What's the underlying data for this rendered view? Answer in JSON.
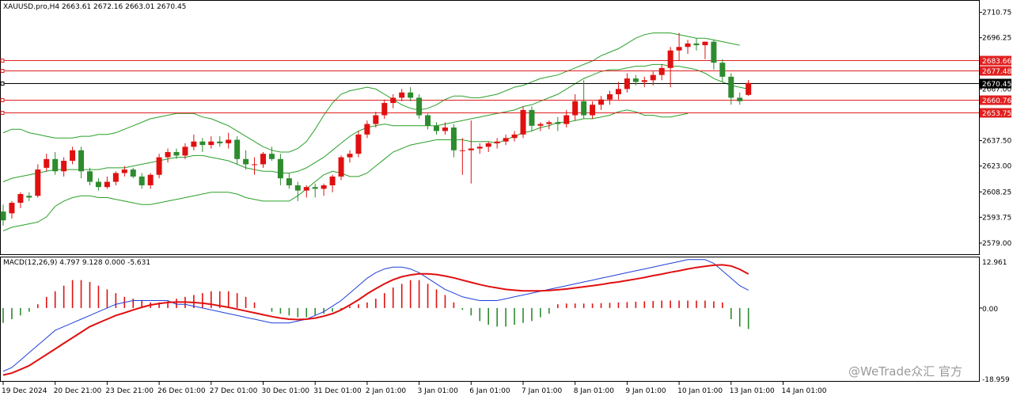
{
  "header": {
    "symbol_text": "XAUUSD.pro,H4  2663.61 2672.16 2663.01 2670.45"
  },
  "macd": {
    "label": "MACD(12,26,9) 4.797 9.128 0.000 -5.631",
    "axis": {
      "top": "12.961",
      "zero": "0.00",
      "bottom": "-18.959"
    },
    "colors": {
      "macd_line": "#1f3fd8",
      "signal_line": "#e01010",
      "hist_pos": "#e01010",
      "hist_neg": "#2e8b2e"
    }
  },
  "price_axis": {
    "labels": [
      "2710.75",
      "2696.25",
      "2683.66",
      "2677.48",
      "2670.45",
      "2667.00",
      "2660.76",
      "2653.75",
      "2637.50",
      "2623.00",
      "2608.25",
      "2593.75",
      "2579.00"
    ]
  },
  "levels": [
    {
      "value": 2683.66,
      "label": "2683.66",
      "color": "#e02020"
    },
    {
      "value": 2677.48,
      "label": "2677.48",
      "color": "#e02020"
    },
    {
      "value": 2670.45,
      "label": "2670.45",
      "color": "#000000"
    },
    {
      "value": 2660.76,
      "label": "2660.76",
      "color": "#e02020"
    },
    {
      "value": 2653.75,
      "label": "2653.75",
      "color": "#e02020"
    }
  ],
  "time_axis": {
    "labels": [
      "19 Dec 2024",
      "20 Dec 21:00",
      "23 Dec 21:00",
      "26 Dec 01:00",
      "27 Dec 01:00",
      "30 Dec 01:00",
      "31 Dec 01:00",
      "2 Jan 01:00",
      "3 Jan 01:00",
      "6 Jan 01:00",
      "7 Jan 01:00",
      "8 Jan 01:00",
      "9 Jan 01:00",
      "10 Jan 01:00",
      "13 Jan 01:00",
      "14 Jan 01:00"
    ]
  },
  "watermark": "@WeTrade众汇 官方",
  "colors": {
    "bull": "#e01010",
    "bear": "#2e8b2e",
    "band": "#2aa02a",
    "grid": "#c8c8c8",
    "current_label_bg": "#000000"
  },
  "chart_data": {
    "type": "candlestick",
    "symbol": "XAUUSD.pro",
    "timeframe": "H4",
    "ylim": [
      2574,
      2716
    ],
    "ohlc": [
      [
        2597,
        2601,
        2589,
        2592
      ],
      [
        2596,
        2603,
        2593,
        2602
      ],
      [
        2602,
        2608,
        2599,
        2607
      ],
      [
        2606,
        2608,
        2603,
        2605
      ],
      [
        2606,
        2624,
        2605,
        2621
      ],
      [
        2622,
        2630,
        2620,
        2627
      ],
      [
        2627,
        2631,
        2618,
        2620
      ],
      [
        2620,
        2628,
        2617,
        2626
      ],
      [
        2626,
        2634,
        2624,
        2632
      ],
      [
        2632,
        2634,
        2616,
        2620
      ],
      [
        2620,
        2622,
        2612,
        2614
      ],
      [
        2614,
        2616,
        2609,
        2611
      ],
      [
        2611,
        2617,
        2610,
        2614
      ],
      [
        2614,
        2620,
        2612,
        2619
      ],
      [
        2619,
        2623,
        2617,
        2621
      ],
      [
        2621,
        2622,
        2616,
        2617
      ],
      [
        2617,
        2619,
        2610,
        2612
      ],
      [
        2612,
        2619,
        2610,
        2618
      ],
      [
        2618,
        2630,
        2616,
        2628
      ],
      [
        2628,
        2633,
        2625,
        2631
      ],
      [
        2631,
        2633,
        2627,
        2629
      ],
      [
        2629,
        2636,
        2627,
        2634
      ],
      [
        2634,
        2641,
        2632,
        2637
      ],
      [
        2637,
        2639,
        2631,
        2635
      ],
      [
        2635,
        2640,
        2633,
        2637
      ],
      [
        2637,
        2640,
        2634,
        2636
      ],
      [
        2636,
        2642,
        2633,
        2638
      ],
      [
        2638,
        2640,
        2624,
        2627
      ],
      [
        2627,
        2632,
        2621,
        2624
      ],
      [
        2624,
        2628,
        2618,
        2624
      ],
      [
        2624,
        2631,
        2622,
        2630
      ],
      [
        2630,
        2634,
        2626,
        2627
      ],
      [
        2627,
        2630,
        2612,
        2616
      ],
      [
        2616,
        2619,
        2610,
        2612
      ],
      [
        2612,
        2614,
        2603,
        2609
      ],
      [
        2609,
        2612,
        2605,
        2611
      ],
      [
        2611,
        2613,
        2605,
        2610
      ],
      [
        2610,
        2613,
        2606,
        2612
      ],
      [
        2612,
        2618,
        2608,
        2617
      ],
      [
        2617,
        2629,
        2615,
        2628
      ],
      [
        2628,
        2632,
        2625,
        2630
      ],
      [
        2630,
        2643,
        2628,
        2641
      ],
      [
        2641,
        2649,
        2639,
        2647
      ],
      [
        2647,
        2654,
        2645,
        2652
      ],
      [
        2652,
        2661,
        2650,
        2659
      ],
      [
        2659,
        2664,
        2656,
        2662
      ],
      [
        2662,
        2667,
        2660,
        2665
      ],
      [
        2665,
        2668,
        2660,
        2662
      ],
      [
        2662,
        2664,
        2650,
        2652
      ],
      [
        2652,
        2653,
        2644,
        2646
      ],
      [
        2646,
        2648,
        2641,
        2643
      ],
      [
        2643,
        2648,
        2641,
        2645
      ],
      [
        2645,
        2647,
        2628,
        2632
      ],
      [
        2632,
        2639,
        2618,
        2632
      ],
      [
        2632,
        2649,
        2613,
        2633
      ],
      [
        2633,
        2636,
        2630,
        2634
      ],
      [
        2634,
        2637,
        2631,
        2636
      ],
      [
        2636,
        2639,
        2633,
        2637
      ],
      [
        2637,
        2641,
        2635,
        2639
      ],
      [
        2639,
        2643,
        2637,
        2641
      ],
      [
        2641,
        2657,
        2639,
        2655
      ],
      [
        2655,
        2657,
        2643,
        2646
      ],
      [
        2646,
        2648,
        2643,
        2647
      ],
      [
        2647,
        2649,
        2644,
        2648
      ],
      [
        2648,
        2651,
        2643,
        2647
      ],
      [
        2647,
        2655,
        2645,
        2652
      ],
      [
        2652,
        2664,
        2649,
        2660
      ],
      [
        2660,
        2672,
        2650,
        2652
      ],
      [
        2652,
        2660,
        2650,
        2658
      ],
      [
        2658,
        2663,
        2655,
        2661
      ],
      [
        2661,
        2666,
        2658,
        2664
      ],
      [
        2664,
        2671,
        2661,
        2667
      ],
      [
        2667,
        2676,
        2665,
        2673
      ],
      [
        2673,
        2675,
        2669,
        2671
      ],
      [
        2671,
        2674,
        2668,
        2672
      ],
      [
        2672,
        2677,
        2669,
        2675
      ],
      [
        2675,
        2681,
        2672,
        2679
      ],
      [
        2679,
        2691,
        2668,
        2689
      ],
      [
        2689,
        2699,
        2683,
        2691
      ],
      [
        2691,
        2695,
        2687,
        2693
      ],
      [
        2693,
        2696,
        2689,
        2692
      ],
      [
        2692,
        2694,
        2684,
        2694
      ],
      [
        2694,
        2695,
        2678,
        2682
      ],
      [
        2682,
        2684,
        2671,
        2674
      ],
      [
        2674,
        2676,
        2658,
        2662
      ],
      [
        2662,
        2665,
        2658,
        2660
      ],
      [
        2663.61,
        2672.16,
        2663.01,
        2670.45
      ]
    ],
    "bollinger_upper": [
      2642,
      2644,
      2644,
      2642,
      2641,
      2640,
      2639,
      2639,
      2639,
      2640,
      2640,
      2641,
      2641,
      2642,
      2644,
      2646,
      2648,
      2650,
      2651,
      2652,
      2653,
      2653,
      2653,
      2651,
      2650,
      2648,
      2646,
      2643,
      2640,
      2637,
      2634,
      2632,
      2631,
      2631,
      2633,
      2637,
      2644,
      2652,
      2659,
      2664,
      2666,
      2667,
      2668,
      2667,
      2664,
      2661,
      2658,
      2656,
      2655,
      2656,
      2658,
      2661,
      2663,
      2663,
      2662,
      2662,
      2663,
      2664,
      2666,
      2668,
      2669,
      2671,
      2673,
      2674,
      2675,
      2677,
      2679,
      2681,
      2683,
      2686,
      2688,
      2690,
      2693,
      2696,
      2698,
      2699,
      2699,
      2699,
      2698,
      2697,
      2696,
      2696,
      2695,
      2694,
      2693,
      2692
    ],
    "bollinger_middle": [
      2614,
      2616,
      2617,
      2618,
      2619,
      2620,
      2621,
      2621,
      2621,
      2621,
      2621,
      2621,
      2622,
      2622,
      2622,
      2623,
      2624,
      2625,
      2626,
      2627,
      2628,
      2628,
      2629,
      2629,
      2628,
      2627,
      2626,
      2624,
      2622,
      2621,
      2620,
      2620,
      2619,
      2619,
      2620,
      2622,
      2625,
      2628,
      2632,
      2636,
      2640,
      2643,
      2645,
      2646,
      2647,
      2646,
      2646,
      2646,
      2646,
      2646,
      2646,
      2647,
      2648,
      2649,
      2650,
      2651,
      2652,
      2653,
      2654,
      2655,
      2657,
      2658,
      2660,
      2662,
      2664,
      2667,
      2670,
      2673,
      2675,
      2677,
      2678,
      2678,
      2679,
      2680,
      2680,
      2681,
      2681,
      2680,
      2680,
      2679,
      2678,
      2676,
      2673,
      2671,
      2669,
      2668,
      2667
    ],
    "bollinger_lower": [
      2586,
      2588,
      2589,
      2590,
      2591,
      2594,
      2600,
      2603,
      2605,
      2606,
      2606,
      2605,
      2605,
      2604,
      2603,
      2602,
      2601,
      2601,
      2602,
      2603,
      2604,
      2605,
      2606,
      2607,
      2608,
      2608,
      2608,
      2607,
      2605,
      2604,
      2603,
      2603,
      2603,
      2603,
      2606,
      2610,
      2614,
      2618,
      2620,
      2619,
      2617,
      2617,
      2619,
      2623,
      2627,
      2631,
      2633,
      2635,
      2636,
      2637,
      2638,
      2638,
      2638,
      2638,
      2637,
      2637,
      2637,
      2636,
      2638,
      2640,
      2642,
      2643,
      2645,
      2646,
      2648,
      2648,
      2649,
      2650,
      2650,
      2651,
      2652,
      2654,
      2655,
      2654,
      2652,
      2652,
      2651,
      2651,
      2652,
      2653
    ],
    "macd_ylim": [
      -18.959,
      12.961
    ],
    "macd_main": [
      -17,
      -16,
      -14,
      -12,
      -10,
      -8,
      -6,
      -5,
      -4,
      -3,
      -2,
      -1,
      0,
      1,
      1.5,
      2,
      2,
      2,
      2,
      2,
      1,
      1,
      0.5,
      0,
      -0.5,
      -1,
      -1.5,
      -2,
      -2.5,
      -3,
      -3.5,
      -4,
      -4,
      -4,
      -3.5,
      -3,
      -2,
      -1,
      0.5,
      2,
      4,
      6,
      8,
      9.5,
      10.5,
      11,
      11,
      10.5,
      9.5,
      8,
      6.5,
      5,
      4,
      3,
      2.5,
      2,
      2,
      2,
      2.5,
      3,
      3.5,
      4,
      4.5,
      5,
      5.5,
      6,
      6.5,
      7,
      7.5,
      8,
      8.5,
      9,
      9.5,
      10,
      10.5,
      11,
      11.5,
      12,
      12.5,
      13,
      13,
      13,
      12,
      10,
      8,
      6,
      4.797
    ],
    "macd_signal": [
      -18,
      -17.5,
      -16.5,
      -15.5,
      -14,
      -12.5,
      -11,
      -9.5,
      -8,
      -6.5,
      -5,
      -4,
      -3,
      -2,
      -1.3,
      -0.5,
      0.2,
      0.8,
      1.2,
      1.5,
      1.6,
      1.6,
      1.5,
      1.3,
      1,
      0.6,
      0.2,
      -0.3,
      -0.8,
      -1.3,
      -1.8,
      -2.3,
      -2.7,
      -3,
      -3.1,
      -3,
      -2.7,
      -2.2,
      -1.5,
      -0.5,
      0.8,
      2.2,
      3.8,
      5.2,
      6.5,
      7.6,
      8.4,
      8.9,
      9.2,
      9.2,
      9,
      8.6,
      8.1,
      7.5,
      6.9,
      6.3,
      5.8,
      5.4,
      5,
      4.8,
      4.6,
      4.6,
      4.6,
      4.7,
      4.9,
      5.1,
      5.4,
      5.7,
      6,
      6.3,
      6.7,
      7,
      7.4,
      7.8,
      8.2,
      8.7,
      9.1,
      9.6,
      10,
      10.5,
      10.9,
      11.2,
      11.5,
      11.6,
      11.3,
      10.4,
      9.128
    ],
    "macd_hist": [
      -4,
      -3,
      -2,
      -1,
      1,
      3,
      4.5,
      6,
      7.5,
      7.5,
      7,
      6,
      5,
      4,
      3,
      2.5,
      2,
      1.5,
      1.5,
      1.8,
      2.5,
      3,
      3.5,
      4,
      4.5,
      4.5,
      4.5,
      4,
      3,
      1.5,
      0,
      -1,
      -1.5,
      -2,
      -2.5,
      -2.5,
      -2,
      -1.5,
      -1,
      -0.5,
      0.5,
      1,
      1.5,
      2.5,
      4,
      5.5,
      6.5,
      7.5,
      7.5,
      6.5,
      5,
      3.5,
      1.5,
      -0.5,
      -2,
      -3.5,
      -4.5,
      -5,
      -5,
      -4.5,
      -4,
      -3.5,
      -2.5,
      -1.5,
      1,
      1.2,
      1.2,
      1.2,
      1.2,
      1.3,
      1.4,
      1.5,
      1.6,
      1.7,
      1.8,
      1.9,
      2,
      2,
      2,
      2,
      2,
      2,
      1.8,
      1.5,
      -3,
      -5,
      -5.631
    ]
  }
}
